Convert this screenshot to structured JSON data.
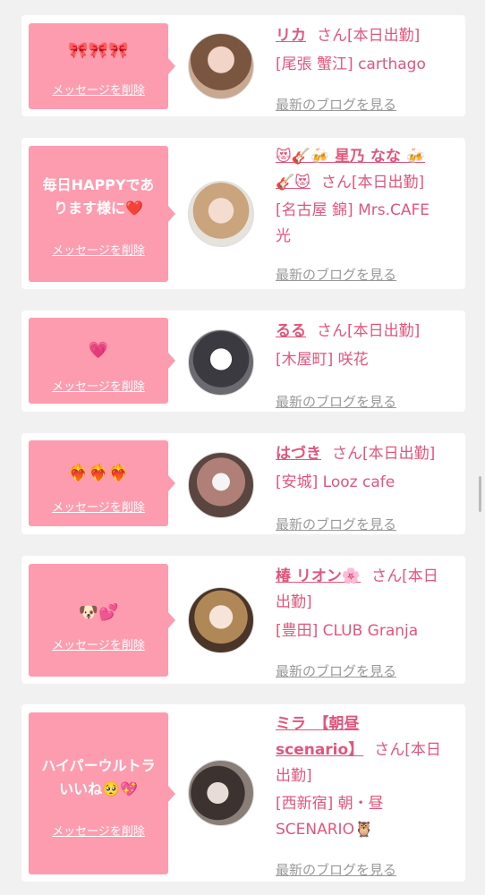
{
  "delete_label": "メッセージを削除",
  "blog_label": "最新のブログを見る",
  "colors": {
    "accent": "#e0567c",
    "bubble": "#fd9caf",
    "background": "#f1f1f1"
  },
  "cards": [
    {
      "message": "🎀🎀🎀",
      "name": "リカ",
      "status": "さん[本日出勤]",
      "shop_line1": "[尾張 蟹江] carthago",
      "shop_line2": ""
    },
    {
      "message_line1": "毎日HAPPYであ",
      "message_line2": "ります様に❤️",
      "name_line1": "😻🎸🍻 星乃 なな 🍻",
      "name_line2": "🎸😻",
      "status": "さん[本日出勤]",
      "shop_line1": "[名古屋 錦] Mrs.CAFE",
      "shop_line2": "光"
    },
    {
      "message": "💗",
      "name": "るる",
      "status": "さん[本日出勤]",
      "shop_line1": "[木屋町] 咲花",
      "shop_line2": ""
    },
    {
      "message": "❤️‍🔥❤️‍🔥❤️‍🔥",
      "name": "はづき",
      "status": "さん[本日出勤]",
      "shop_line1": "[安城] Looz cafe",
      "shop_line2": ""
    },
    {
      "message": "🐶💕",
      "name": "椿 リオン🌸",
      "status_line1": "さん[本日",
      "status_line2": "出勤]",
      "shop_line1": "[豊田] CLUB Granja",
      "shop_line2": ""
    },
    {
      "message_line1": "ハイパーウルトラ",
      "message_line2": "いいね🥺💖",
      "name_line1": "ミラ　【朝昼",
      "name_line2": "scenario】",
      "status_line1": "さん[本日",
      "status_line2": "出勤]",
      "shop_line1": "[西新宿] 朝・昼",
      "shop_line2": "SCENARIO🦉"
    }
  ]
}
